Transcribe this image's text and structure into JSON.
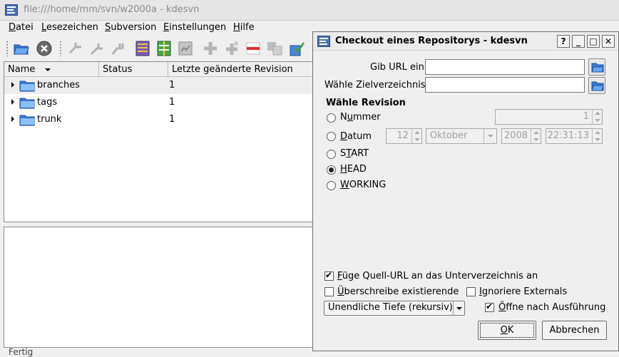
{
  "main_window": {
    "title": "file:///home/mm/svn/w2000a - kdesvn",
    "menu": [
      {
        "pre": "",
        "ul": "D",
        "post": "atei"
      },
      {
        "pre": "",
        "ul": "L",
        "post": "esezeichen"
      },
      {
        "pre": "",
        "ul": "S",
        "post": "ubversion"
      },
      {
        "pre": "",
        "ul": "E",
        "post": "instellungen"
      },
      {
        "pre": "",
        "ul": "H",
        "post": "ilfe"
      }
    ],
    "toolbar_icons": [
      "open-folder-icon",
      "close-icon",
      "merge-icon",
      "merge2-icon",
      "switch-icon",
      "log-icon",
      "diff-icon",
      "info-icon",
      "add-icon",
      "add-recursive-icon",
      "delete-icon",
      "move-icon",
      "commit-icon"
    ],
    "columns": [
      "Name",
      "Status",
      "Letzte geänderte Revision"
    ],
    "rows": [
      {
        "name": "branches",
        "status": "",
        "rev": "1"
      },
      {
        "name": "tags",
        "status": "",
        "rev": "1"
      },
      {
        "name": "trunk",
        "status": "",
        "rev": "1"
      }
    ],
    "statusbar": "Fertig"
  },
  "dialog": {
    "title": "Checkout eines Repositorys - kdesvn",
    "buttons": {
      "help": "?",
      "minimize": "_",
      "maximize": "□",
      "close": "✕"
    },
    "url_label": "Gib URL ein:",
    "url_value": "",
    "target_label": "Wähle Zielverzeichnis:",
    "target_value": "",
    "revision_section": "Wähle Revision",
    "radio_number": {
      "pre": "N",
      "ul": "u",
      "post": "mmer"
    },
    "radio_date": {
      "pre": "",
      "ul": "D",
      "post": "atum"
    },
    "radio_start": {
      "pre": "S",
      "ul": "T",
      "post": "ART"
    },
    "radio_head": {
      "pre": "",
      "ul": "H",
      "post": "EAD"
    },
    "radio_working": {
      "pre": "",
      "ul": "W",
      "post": "ORKING"
    },
    "selected_revision": "HEAD",
    "number_value": "1",
    "day_value": "12",
    "month_value": "Oktober",
    "year_value": "2008",
    "time_value": "22:31:13",
    "append_source": {
      "pre": "",
      "ul": "F",
      "post": "üge Quell-URL an das Unterverzeichnis an",
      "checked": true
    },
    "overwrite": {
      "pre": "",
      "ul": "Ü",
      "post": "berschreibe existierende",
      "checked": false
    },
    "ignore_externals": {
      "pre": "",
      "ul": "I",
      "post": "gnoriere Externals",
      "checked": false
    },
    "depth_value": "Unendliche Tiefe (rekursiv)",
    "open_after": {
      "pre": "",
      "ul": "Ö",
      "post": "ffne nach Ausführung",
      "checked": true
    },
    "ok_label": {
      "pre": "",
      "ul": "O",
      "post": "K"
    },
    "cancel_label": "Abbrechen"
  }
}
